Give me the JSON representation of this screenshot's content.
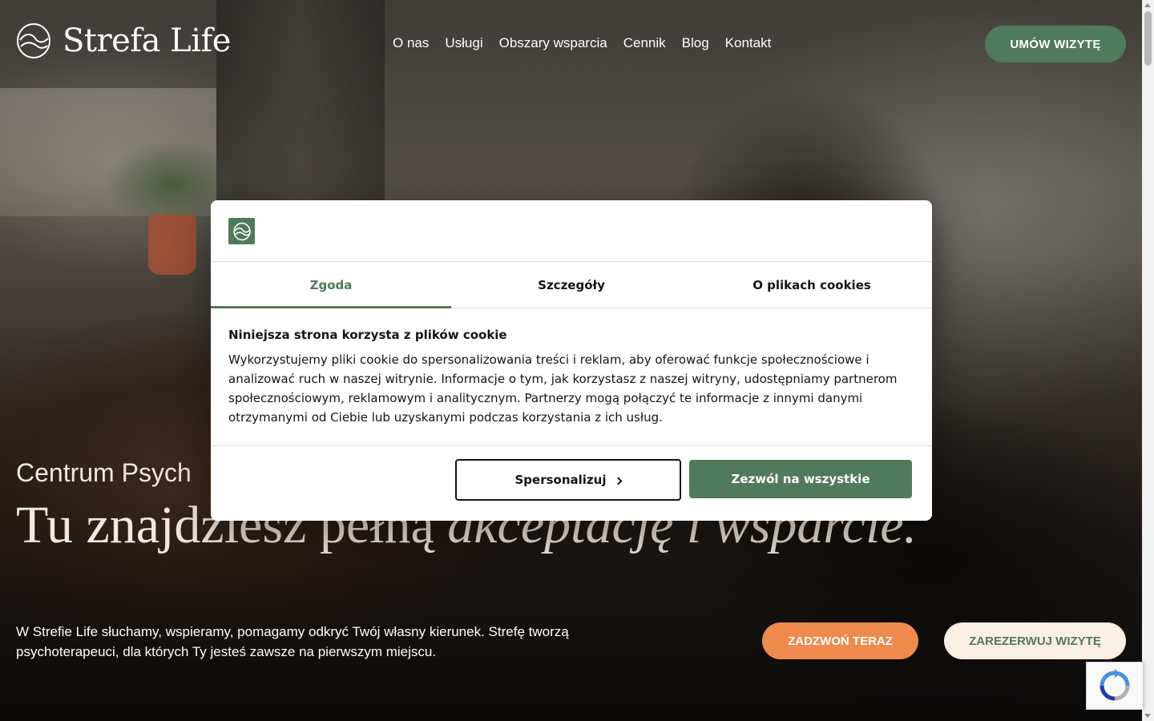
{
  "brand": {
    "name": "Strefa Life",
    "accent": "#4f7a5c",
    "orange": "#ef8a4d",
    "cream": "#fbeee2"
  },
  "nav": {
    "items": [
      "O nas",
      "Usługi",
      "Obszary wsparcia",
      "Cennik",
      "Blog",
      "Kontakt"
    ]
  },
  "header": {
    "cta_label": "UMÓW WIZYTĘ"
  },
  "hero": {
    "subtitle": "Centrum Psych",
    "title_regular": "Tu znajdziesz pełną ",
    "title_italic": "akceptację i wsparcie.",
    "description": "W Strefie Life słuchamy, wspieramy, pomagamy odkryć Twój własny kierunek. Strefę tworzą psychoterapeuci, dla których Ty jesteś zawsze na pierwszym miejscu.",
    "call_label": "ZADZWOŃ TERAZ",
    "book_label": "ZAREZERWUJ WIZYTĘ"
  },
  "cookie_dialog": {
    "tabs": [
      "Zgoda",
      "Szczegóły",
      "O plikach cookies"
    ],
    "active_tab": "Zgoda",
    "heading": "Niniejsza strona korzysta z plików cookie",
    "body": "Wykorzystujemy pliki cookie do spersonalizowania treści i reklam, aby oferować funkcje społecznościowe i analizować ruch w naszej witrynie. Informacje o tym, jak korzystasz z naszej witryny, udostępniamy partnerom społecznościowym, reklamowym i analitycznym. Partnerzy mogą połączyć te informacje z innymi danymi otrzymanymi od Ciebie lub uzyskanymi podczas korzystania z ich usług.",
    "personalize_label": "Spersonalizuj",
    "allow_all_label": "Zezwól na wszystkie"
  }
}
